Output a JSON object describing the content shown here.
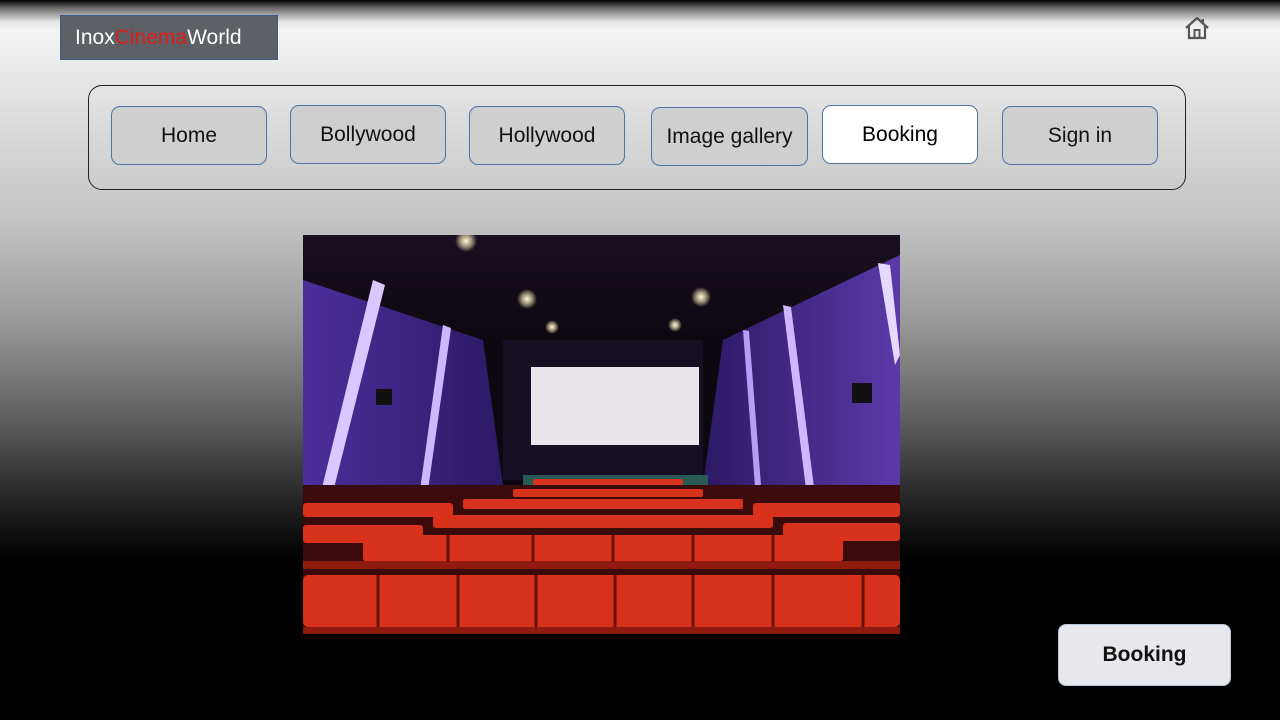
{
  "brand": {
    "part1": "Inox ",
    "part2": "Cinema",
    "part3": " World",
    "accent_color": "#e01b1b"
  },
  "home_icon": "home-icon",
  "nav": {
    "items": [
      {
        "label": "Home",
        "active": false
      },
      {
        "label": "Bollywood",
        "active": false
      },
      {
        "label": "Hollywood",
        "active": false
      },
      {
        "label": "Image gallery",
        "active": false
      },
      {
        "label": "Booking",
        "active": true
      },
      {
        "label": "Sign in",
        "active": false
      }
    ]
  },
  "hero": {
    "image": "cinema-hall-photo"
  },
  "cta": {
    "label": "Booking"
  }
}
